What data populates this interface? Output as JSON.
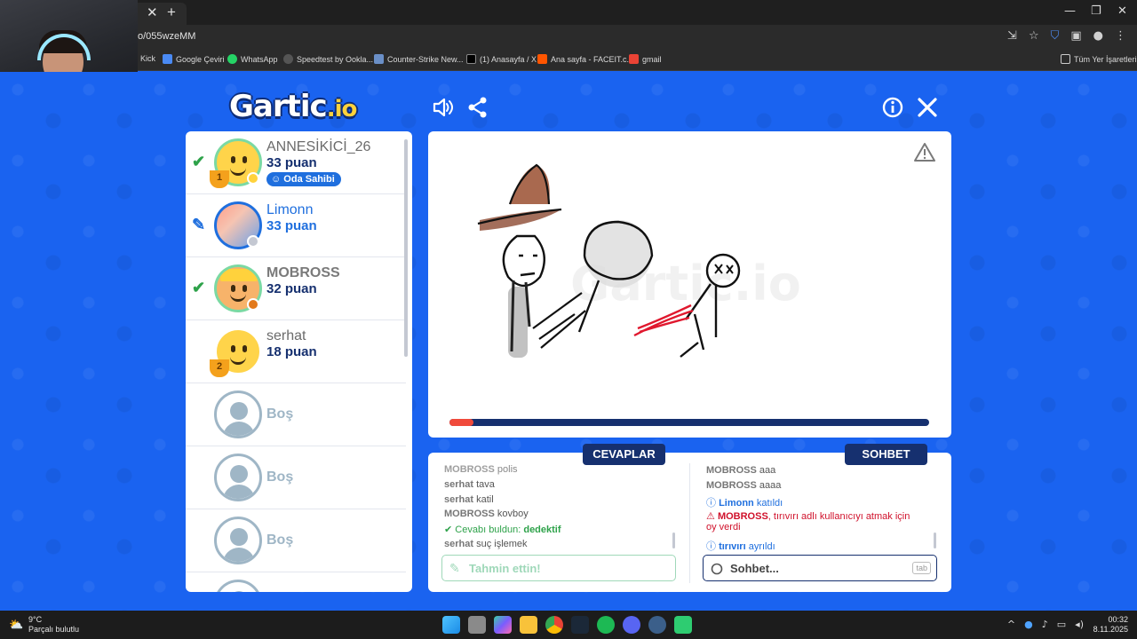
{
  "browser": {
    "url": "o/055wzeMM",
    "bookmarks": [
      "Kick",
      "Google Çeviri",
      "WhatsApp",
      "Speedtest by Ookla...",
      "Counter-Strike New...",
      "(1) Anasayfa / X",
      "Ana sayfa - FACEIT.c...",
      "gmail"
    ],
    "all_bookmarks": "Tüm Yer İşaretleri"
  },
  "game": {
    "logo_main": "Gartic",
    "logo_suffix": ".io"
  },
  "players": [
    {
      "name": "ANNESİKİCİ_26",
      "score": "33 puan",
      "badge": "Oda Sahibi",
      "rank": "1"
    },
    {
      "name": "Limonn",
      "score": "33 puan"
    },
    {
      "name": "MOBROSS",
      "score": "32 puan"
    },
    {
      "name": "serhat",
      "score": "18 puan",
      "rank": "2"
    },
    {
      "name": "Boş"
    },
    {
      "name": "Boş"
    },
    {
      "name": "Boş"
    }
  ],
  "timer_progress_pct": 5,
  "answers": {
    "title": "CEVAPLAR",
    "messages": [
      {
        "user": "MOBROSS",
        "text": "polis"
      },
      {
        "user": "serhat",
        "text": "tava"
      },
      {
        "user": "serhat",
        "text": "katil"
      },
      {
        "user": "MOBROSS",
        "text": "kovboy"
      },
      {
        "label": "Cevabı buldun:",
        "answer": "dedektif"
      },
      {
        "user": "serhat",
        "text": "suç işlemek"
      }
    ],
    "placeholder": "Tahmin ettin!"
  },
  "chat": {
    "title": "SOHBET",
    "messages": [
      {
        "user": "MOBROSS",
        "text": "aaa"
      },
      {
        "user": "MOBROSS",
        "text": "aaaa"
      },
      {
        "user": "Limonn",
        "text": "katıldı"
      },
      {
        "user": "MOBROSS",
        "text": ", tırıvırı adlı kullanıcıyı atmak için",
        "text2": "oy verdi"
      },
      {
        "user": "tırıvırı",
        "text": "ayrıldı"
      }
    ],
    "placeholder": "Sohbet...",
    "key_hint": "tab"
  },
  "taskbar": {
    "temp": "9°C",
    "weather": "Parçalı bulutlu",
    "time": "00:32",
    "date": "8.11.2025"
  },
  "colors": {
    "background": "#1a63f0",
    "navy": "#16306f",
    "accent_blue": "#1f6fde",
    "green": "#2ea24a",
    "red": "#d0112b",
    "progress": "#f04a3b"
  }
}
